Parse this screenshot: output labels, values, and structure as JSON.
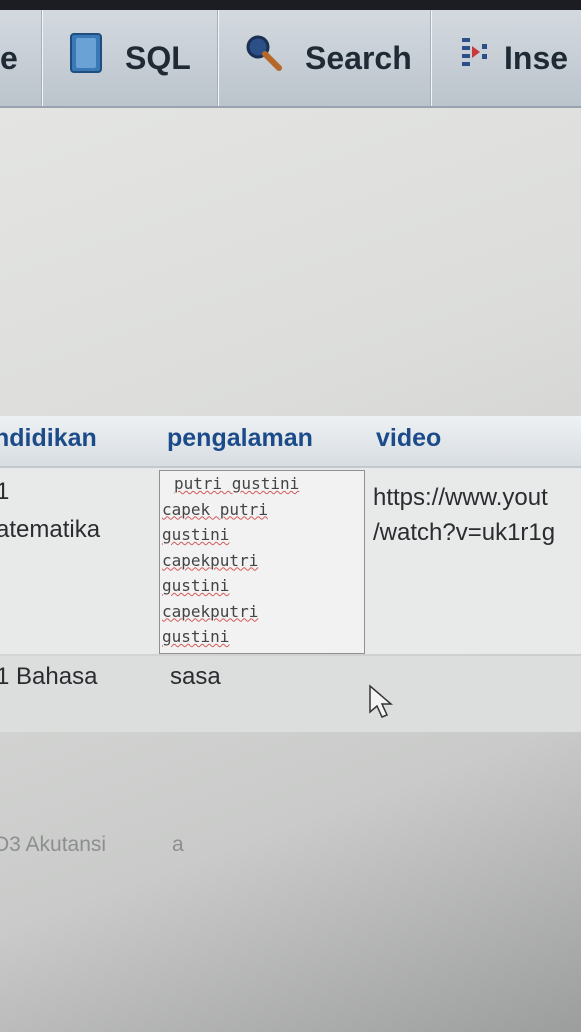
{
  "tabs": {
    "prev_label": "e",
    "sql_label": "SQL",
    "search_label": "Search",
    "insert_label": "Inse"
  },
  "icons": {
    "sql": "sql-icon",
    "search": "search-icon",
    "insert": "insert-icon"
  },
  "columns": [
    "ndidikan",
    "pengalaman",
    "video"
  ],
  "rows": [
    {
      "pendidikan_top": "1",
      "pendidikan": "atematika",
      "pengalaman_lines": [
        "putri gustini",
        "capek putri",
        "gustini",
        "capekputri",
        "gustini",
        "capekputri",
        "gustini"
      ],
      "video_lines": [
        "https://www.yout",
        "/watch?v=uk1r1g"
      ]
    },
    {
      "pendidikan": "1 Bahasa",
      "pengalaman": "sasa"
    },
    {
      "pendidikan": "D3 Akutansi",
      "pengalaman": "a"
    }
  ],
  "colors": {
    "header_text": "#1c4b8a",
    "tab_bar": "#c8cfd6",
    "spellcheck_underline": "#d35a5a"
  }
}
